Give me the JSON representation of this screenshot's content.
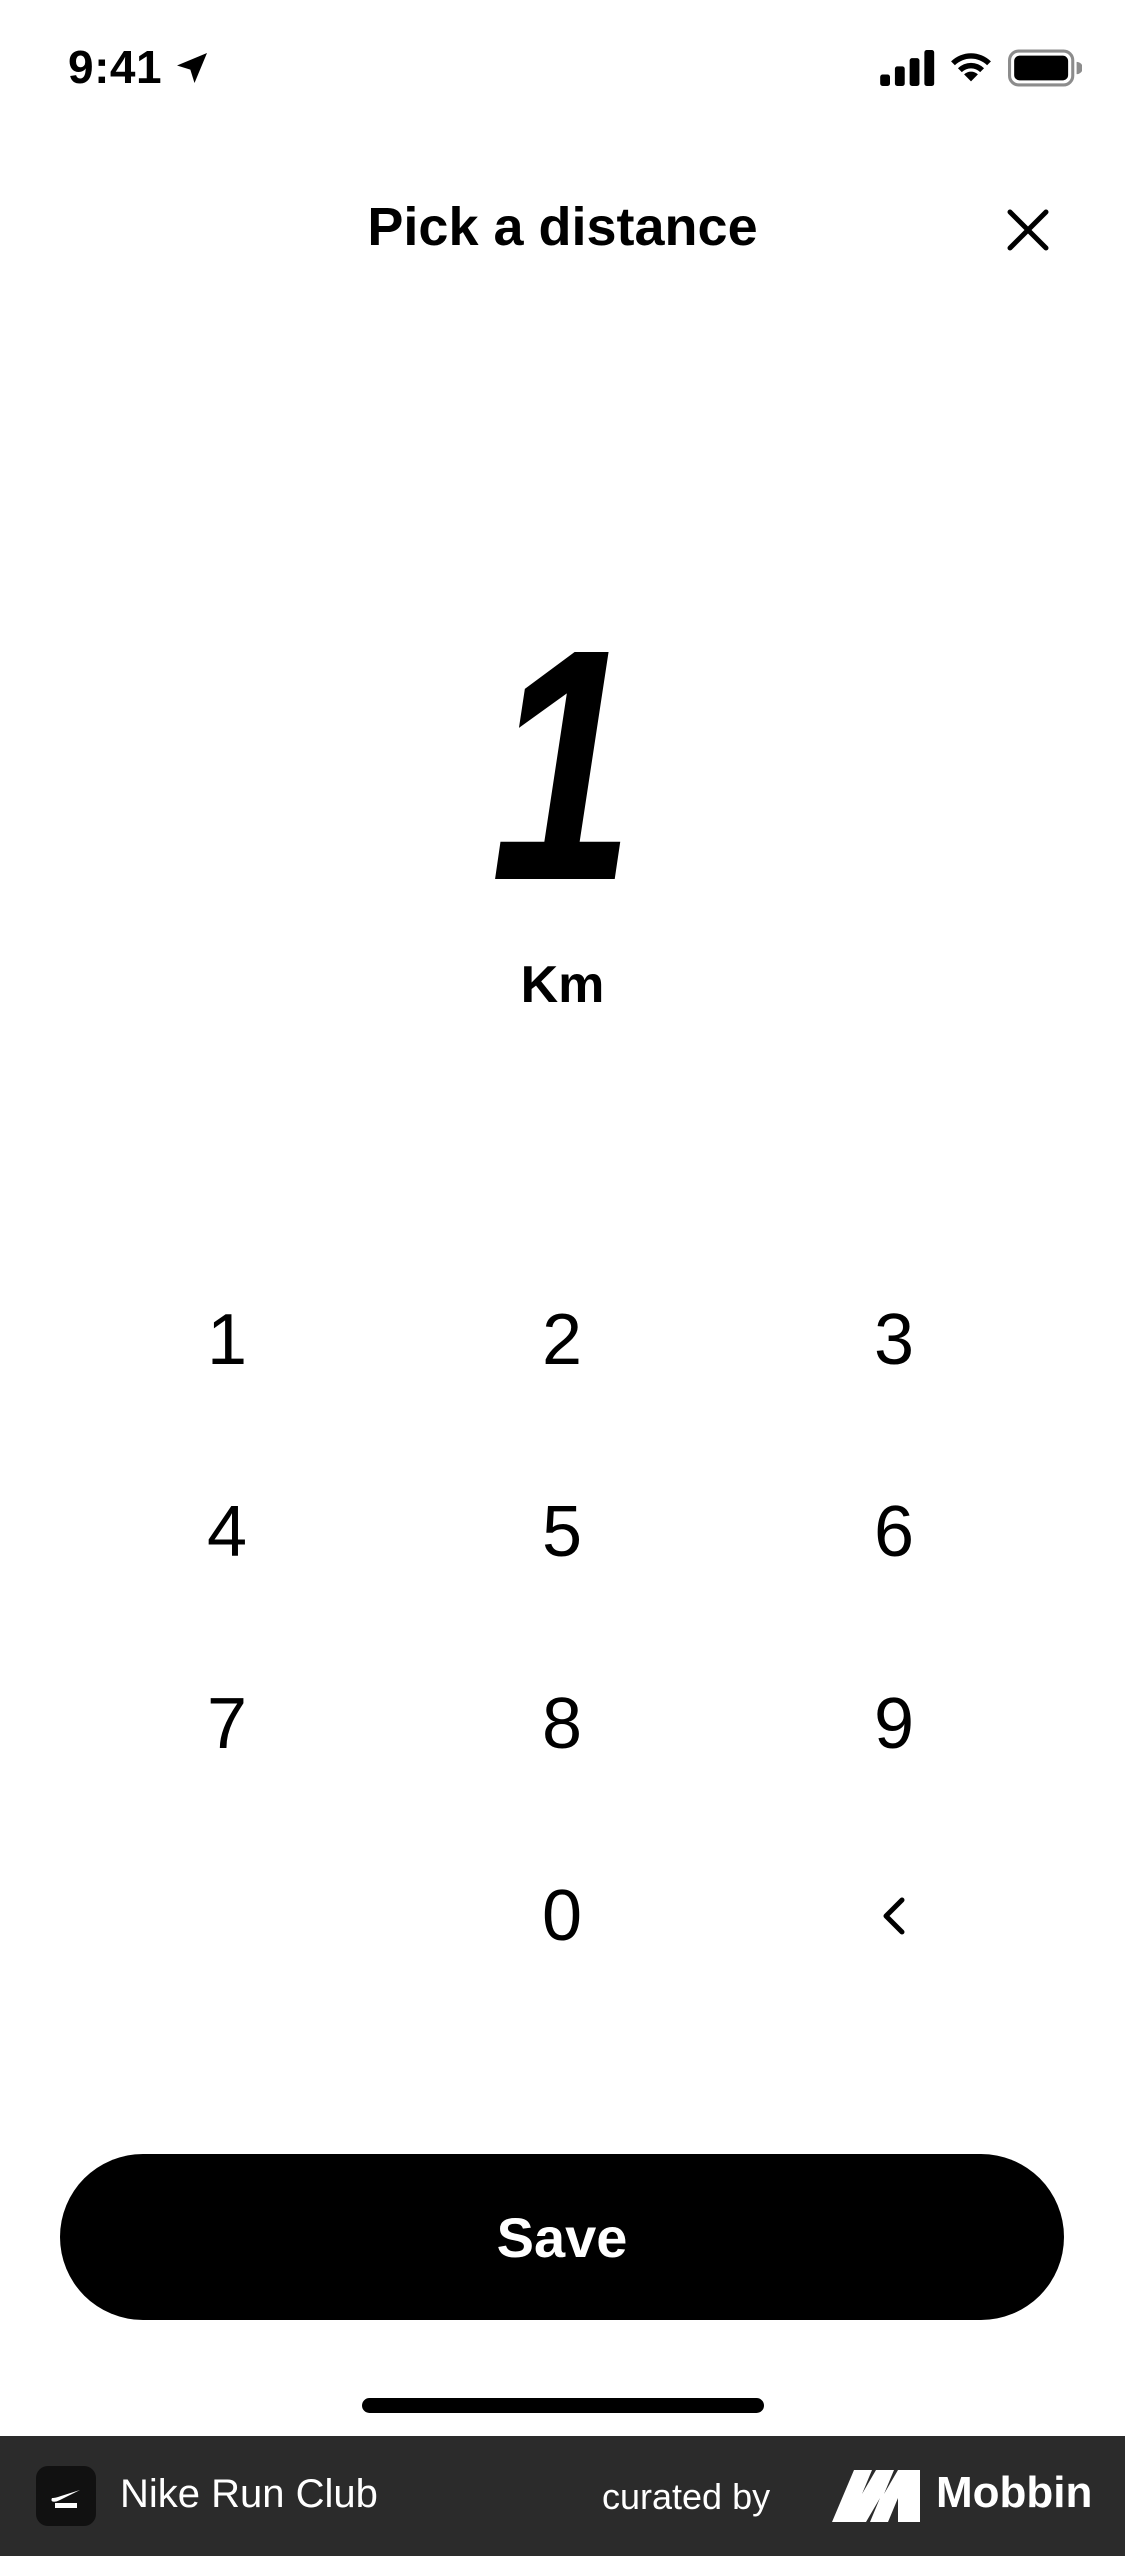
{
  "status_bar": {
    "time": "9:41"
  },
  "header": {
    "title": "Pick a distance"
  },
  "distance": {
    "value": "1",
    "unit": "Km"
  },
  "keypad": {
    "keys": [
      "1",
      "2",
      "3",
      "4",
      "5",
      "6",
      "7",
      "8",
      "9",
      "0"
    ]
  },
  "actions": {
    "save_label": "Save"
  },
  "footer": {
    "app_name": "Nike Run Club",
    "curated_by": "curated by",
    "brand": "Mobbin"
  },
  "colors": {
    "background": "#ffffff",
    "text": "#000000",
    "save_button": "#000000",
    "footer_background": "#2b2b2b"
  },
  "icons": {
    "location": "location-arrow-icon",
    "signal": "cellular-signal-icon",
    "wifi": "wifi-icon",
    "battery": "battery-icon",
    "close": "close-icon",
    "backspace": "chevron-left-icon"
  }
}
